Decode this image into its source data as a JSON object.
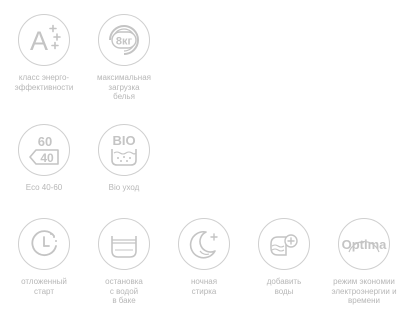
{
  "colors": {
    "icon_stroke": "#c9c9c9",
    "icon_fill": "#c4c4c4",
    "caption_text": "#b7b7b7",
    "background": "#ffffff"
  },
  "features": {
    "energy_class": {
      "icon": "energy-class-a-plus-plus-plus-icon",
      "glyph": "A",
      "caption": [
        "класс энерго-",
        "эффективности"
      ]
    },
    "max_load": {
      "icon": "max-load-8kg-icon",
      "glyph": "8кг",
      "caption": [
        "максимальная",
        "загрузка",
        "белья"
      ]
    },
    "eco_40_60": {
      "icon": "eco-40-60-icon",
      "glyph_top": "60",
      "glyph_bottom": "40",
      "caption": [
        "Eco 40-60"
      ]
    },
    "bio_care": {
      "icon": "bio-care-icon",
      "glyph": "BIO",
      "caption": [
        "Bio уход"
      ]
    },
    "delayed_start": {
      "icon": "delayed-start-icon",
      "caption": [
        "отложенный",
        "старт"
      ]
    },
    "stop_with_water": {
      "icon": "stop-with-water-icon",
      "caption": [
        "остановка",
        "с водой",
        "в баке"
      ]
    },
    "night_wash": {
      "icon": "night-wash-icon",
      "caption": [
        "ночная",
        "стирка"
      ]
    },
    "add_water": {
      "icon": "add-water-icon",
      "caption": [
        "добавить",
        "воды"
      ]
    },
    "optima": {
      "icon": "optima-icon",
      "glyph": "Optima",
      "caption": [
        "режим экономии",
        "электроэнергии и",
        "времени"
      ]
    }
  }
}
